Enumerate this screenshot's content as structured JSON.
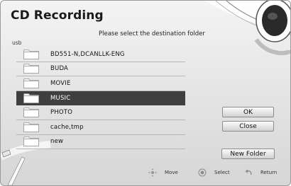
{
  "dialog": {
    "title": "CD Recording",
    "instruction": "Please select the destination folder",
    "path": "usb"
  },
  "folders": [
    {
      "name": "BD551-N,DCANLLK-ENG",
      "selected": false
    },
    {
      "name": "BUDA",
      "selected": false
    },
    {
      "name": "MOVIE",
      "selected": false
    },
    {
      "name": "MUSIC",
      "selected": true
    },
    {
      "name": "PHOTO",
      "selected": false
    },
    {
      "name": "cache,tmp",
      "selected": false
    },
    {
      "name": "new",
      "selected": false
    }
  ],
  "buttons": {
    "ok": "OK",
    "close": "Close",
    "new_folder": "New Folder"
  },
  "hints": {
    "move": "Move",
    "select": "Select",
    "return": "Return"
  },
  "icons": {
    "folder": "folder-icon",
    "move": "dpad-icon",
    "select": "enter-icon",
    "return": "return-icon"
  },
  "colors": {
    "selected_row": "#3f3f3f",
    "folder_fill": "#f4f4f4"
  }
}
